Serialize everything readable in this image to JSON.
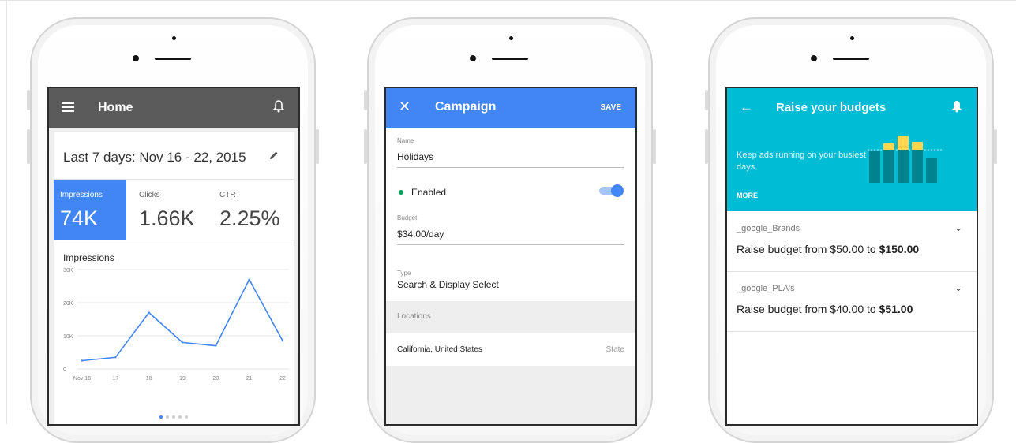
{
  "phone1": {
    "title": "Home",
    "date_range": "Last 7 days: Nov 16 - 22, 2015",
    "metrics": [
      {
        "label": "Impressions",
        "value": "74K"
      },
      {
        "label": "Clicks",
        "value": "1.66K"
      },
      {
        "label": "CTR",
        "value": "2.25%"
      }
    ],
    "chart_title": "Impressions",
    "chart_data": {
      "type": "line",
      "title": "Impressions",
      "categories": [
        "Nov 16",
        "17",
        "18",
        "19",
        "20",
        "21",
        "22"
      ],
      "values": [
        2500,
        3500,
        17000,
        8000,
        7000,
        27000,
        8500
      ],
      "y_ticks": [
        "0",
        "10K",
        "20K",
        "30K"
      ],
      "ylim": [
        0,
        30000
      ],
      "color": "#4285f4"
    },
    "accent_color": "#4285f4"
  },
  "phone2": {
    "title": "Campaign",
    "save_label": "SAVE",
    "name_label": "Name",
    "name_value": "Holidays",
    "status_label": "Enabled",
    "budget_label": "Budget",
    "budget_value": "$34.00/day",
    "type_label": "Type",
    "type_value": "Search & Display Select",
    "locations_header": "Locations",
    "location_value": "California, United States",
    "location_type": "State"
  },
  "phone3": {
    "title": "Raise your budgets",
    "description": "Keep ads running on your busiest days.",
    "more_label": "MORE",
    "header_color": "#00bcd4",
    "items": [
      {
        "account": "_google_Brands",
        "prefix": "Raise budget from $50.00 to ",
        "amount": "$150.00"
      },
      {
        "account": "_google_PLA's",
        "prefix": "Raise budget from $40.00 to ",
        "amount": "$51.00"
      }
    ]
  }
}
